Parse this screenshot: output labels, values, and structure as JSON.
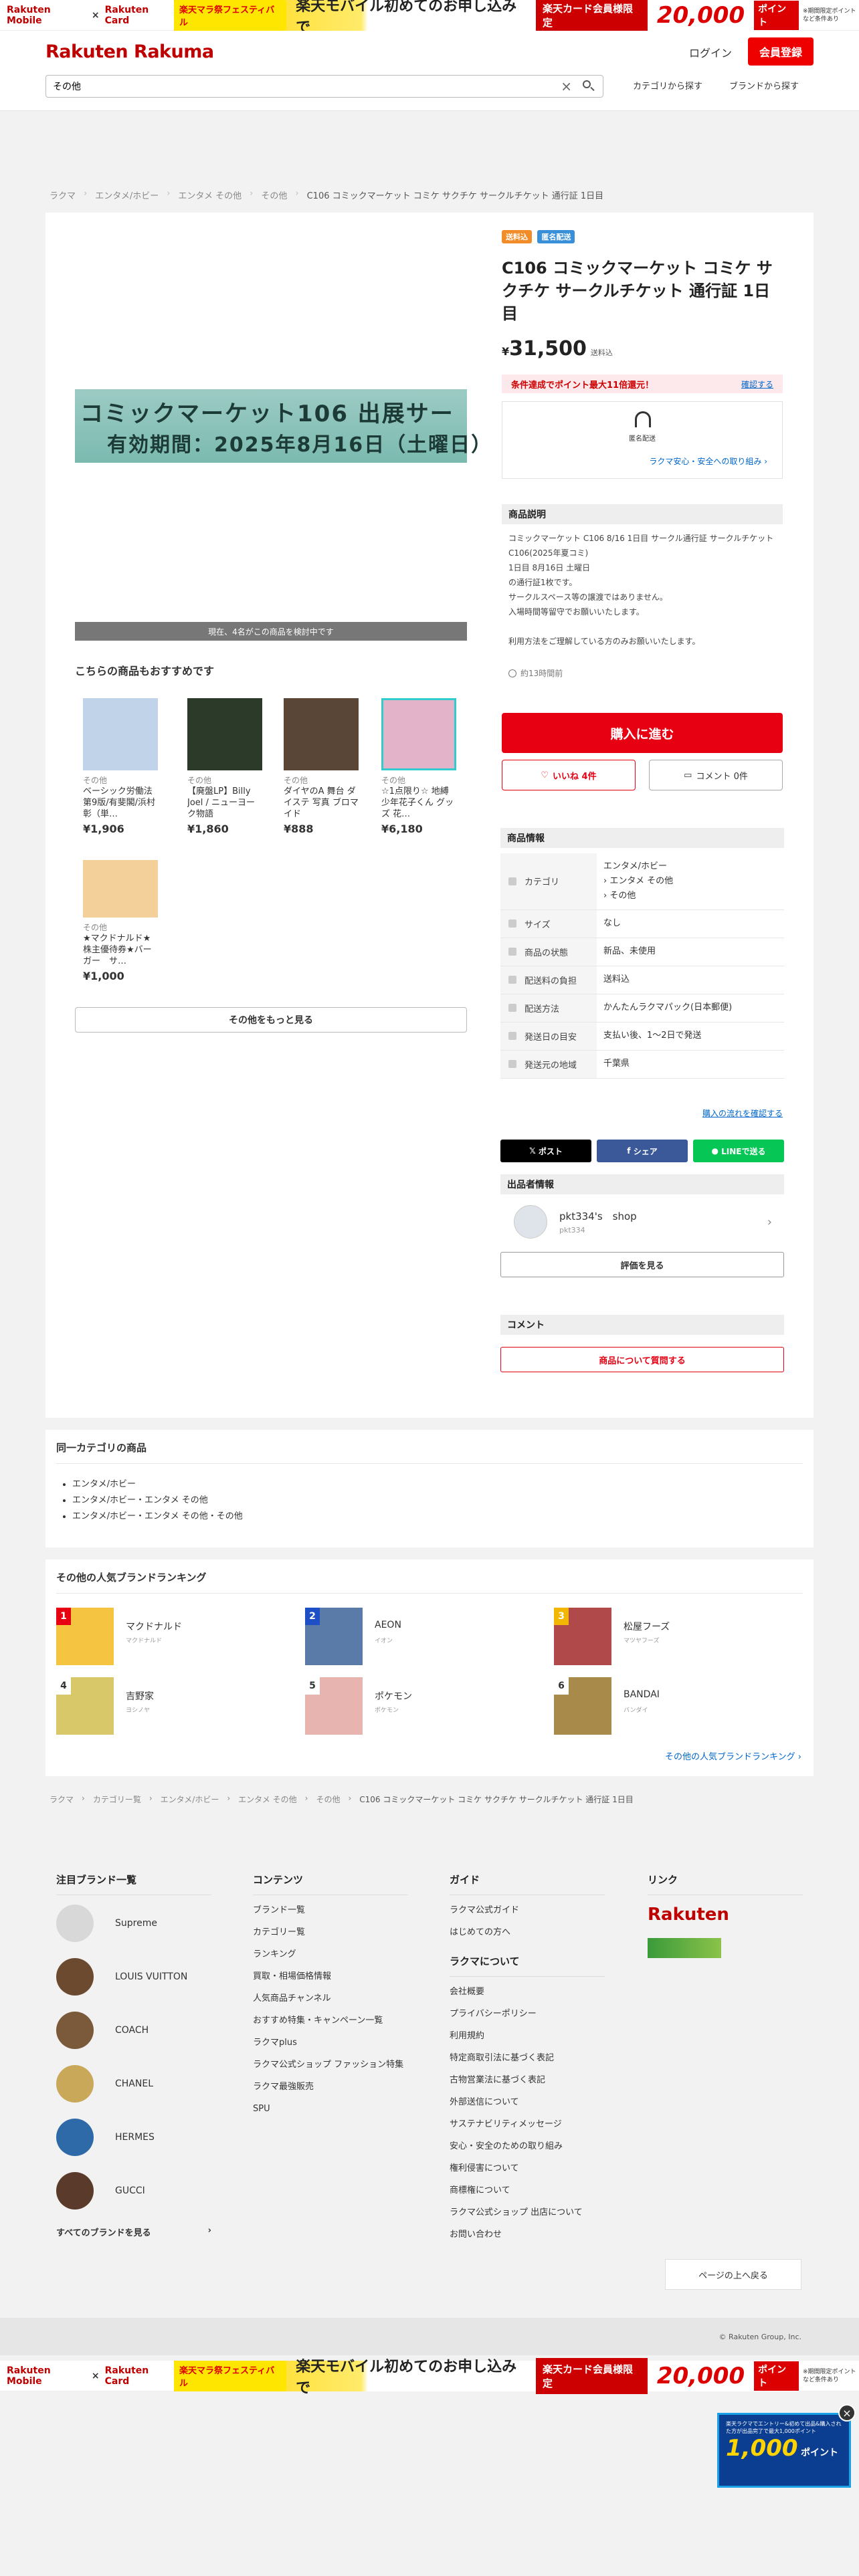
{
  "banner": {
    "mobile": "Rakuten Mobile",
    "card": "Rakuten Card",
    "festival": "楽天マラ祭フェスティバル",
    "headline": "楽天モバイル初めてのお申し込みで",
    "card_cta": "楽天カード会員様限定",
    "points": "20,000",
    "points_unit": "ポイント",
    "note": "※期間限定ポイントなど条件あり"
  },
  "header": {
    "logo": "Rakuten Rakuma",
    "login": "ログイン",
    "signup": "会員登録",
    "search_value": "その他",
    "nav_category": "カテゴリから探す",
    "nav_brand": "ブランドから探す"
  },
  "breadcrumb": [
    "ラクマ",
    "エンタメ/ホビー",
    "エンタメ その他",
    "その他",
    "C106 コミックマーケット コミケ サクチケ サークルチケット 通行証 1日目"
  ],
  "product": {
    "tags": [
      "送料込",
      "匿名配送"
    ],
    "title": "C106 コミックマーケット コミケ サクチケ サークルチケット 通行証 1日目",
    "price_symbol": "¥",
    "price": "31,500",
    "shipping": "送料込",
    "image_line1": "コミックマーケット106 出展サー",
    "image_line2": "有効期間：2025年8月16日（土曜日）",
    "viewers": "現在、4名がこの商品を検討中です",
    "point_text": "条件達成でポイント最大11倍還元！",
    "point_link": "確認する",
    "safe_label": "匿名配送",
    "safe_link": "ラクマ安心・安全への取り組み",
    "desc_heading": "商品説明",
    "description": "コミックマーケット C106 8/16 1日目 サークル通行証 サークルチケット\nC106(2025年夏コミ)\n1日目 8月16日 土曜日\nの通行証1枚です。\nサークルスペース等の譲渡ではありません。\n入場時間等留守でお願いいたします。\n\n利用方法をご理解している方のみお願いいたします。",
    "posted": "約13時間前",
    "buy": "購入に進む",
    "like": "いいね 4件",
    "comment": "コメント 0件"
  },
  "recommend": {
    "title": "こちらの商品もおすすめです",
    "items": [
      {
        "cat": "その他",
        "name": "ベーシック労働法 第9版/有斐閣/浜村彰（単…",
        "price": "¥1,906",
        "color": "#c0d3e8"
      },
      {
        "cat": "その他",
        "name": "【廃盤LP】Billy Joel / ニューヨーク物語",
        "price": "¥1,860",
        "color": "#2c3a2a"
      },
      {
        "cat": "その他",
        "name": "ダイヤのA 舞台 ダイステ 写真 ブロマイド",
        "price": "¥888",
        "color": "#5a4636"
      },
      {
        "cat": "その他",
        "name": "☆1点限り☆ 地縛少年花子くん グッズ 花…",
        "price": "¥6,180",
        "color": "#e3b4c9"
      },
      {
        "cat": "その他",
        "name": "★マクドナルド★株主優待券★バーガー　サ…",
        "price": "¥1,000",
        "color": "#f3cf9a"
      }
    ],
    "more": "その他をもっと見る"
  },
  "details": {
    "heading": "商品情報",
    "rows": [
      {
        "k": "カテゴリ",
        "v": "エンタメ/ホビー\n› エンタメ その他\n› その他"
      },
      {
        "k": "サイズ",
        "v": "なし"
      },
      {
        "k": "商品の状態",
        "v": "新品、未使用"
      },
      {
        "k": "配送料の負担",
        "v": "送料込"
      },
      {
        "k": "配送方法",
        "v": "かんたんラクマパック(日本郵便)"
      },
      {
        "k": "発送日の目安",
        "v": "支払い後、1〜2日で発送"
      },
      {
        "k": "発送元の地域",
        "v": "千葉県"
      }
    ],
    "flow_link": "購入の流れを確認する"
  },
  "share": {
    "x": "ポスト",
    "fb": "シェア",
    "line": "LINEで送る"
  },
  "seller": {
    "heading": "出品者情報",
    "name": "pkt334's　shop",
    "id": "pkt334",
    "eval": "評価を見る"
  },
  "comments": {
    "heading": "コメント",
    "ask": "商品について質問する"
  },
  "same_category": {
    "title": "同一カテゴリの商品",
    "links": [
      "エンタメ/ホビー",
      "エンタメ/ホビー・エンタメ その他",
      "エンタメ/ホビー・エンタメ その他・その他"
    ]
  },
  "ranking": {
    "title": "その他の人気ブランドランキング",
    "items": [
      {
        "rank": "1",
        "name": "マクドナルド",
        "kana": "マクドナルド"
      },
      {
        "rank": "2",
        "name": "AEON",
        "kana": "イオン"
      },
      {
        "rank": "3",
        "name": "松屋フーズ",
        "kana": "マツヤフーズ"
      },
      {
        "rank": "4",
        "name": "吉野家",
        "kana": "ヨシノヤ"
      },
      {
        "rank": "5",
        "name": "ポケモン",
        "kana": "ポケモン"
      },
      {
        "rank": "6",
        "name": "BANDAI",
        "kana": "バンダイ"
      }
    ],
    "more": "その他の人気ブランドランキング"
  },
  "breadcrumb2": [
    "ラクマ",
    "カテゴリー覧",
    "エンタメ/ホビー",
    "エンタメ その他",
    "その他",
    "C106 コミックマーケット コミケ サクチケ サークルチケット 通行証 1日目"
  ],
  "footer": {
    "brands_title": "注目ブランド一覧",
    "brands": [
      "Supreme",
      "LOUIS VUITTON",
      "COACH",
      "CHANEL",
      "HERMES",
      "GUCCI"
    ],
    "all_brands": "すべてのブランドを見る",
    "contents_title": "コンテンツ",
    "contents": [
      "ブランド一覧",
      "カテゴリー覧",
      "ランキング",
      "買取・相場価格情報",
      "人気商品チャンネル",
      "おすすめ特集・キャンペーン一覧",
      "ラクマplus",
      "ラクマ公式ショップ ファッション特集",
      "ラクマ最強販売",
      "SPU"
    ],
    "guide_title": "ガイド",
    "guide": [
      "ラクマ公式ガイド",
      "はじめての方へ"
    ],
    "about_title": "ラクマについて",
    "about": [
      "会社概要",
      "プライバシーポリシー",
      "利用規約",
      "特定商取引法に基づく表記",
      "古物営業法に基づく表記",
      "外部送信について",
      "サステナビリティメッセージ",
      "安心・安全のための取り組み",
      "権利侵害について",
      "商標権について",
      "ラクマ公式ショップ 出店について",
      "お問い合わせ"
    ],
    "link_title": "リンク",
    "link_logo": "Rakuten",
    "to_top": "ページの上へ戻る",
    "copyright": "© Rakuten Group, Inc."
  },
  "popup": {
    "text": "楽天ラクマでエントリー&初めて出品&購入された方が出品完了で最大1,000ポイント",
    "amount": "1,000",
    "unit": "ポイント"
  }
}
